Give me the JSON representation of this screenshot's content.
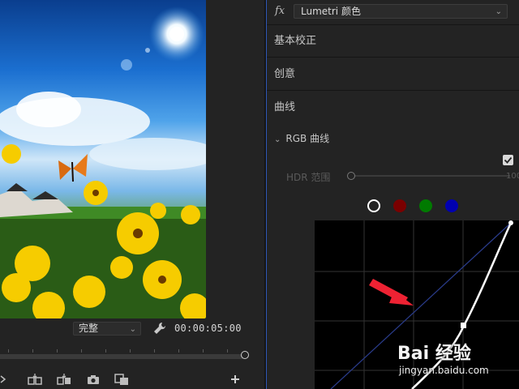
{
  "monitor": {
    "quality": "完整",
    "timecode": "00:00:05:00"
  },
  "lumetri": {
    "effect_label": "fx",
    "effect_name": "Lumetri 颜色",
    "sections": [
      "基本校正",
      "创意",
      "曲线"
    ],
    "rgb_curves": "RGB 曲线",
    "hdr_label": "HDR 范围",
    "hdr_value": "100",
    "channels": [
      {
        "name": "white",
        "color": "#ffffff"
      },
      {
        "name": "red",
        "color": "#7a0000"
      },
      {
        "name": "green",
        "color": "#007a00"
      },
      {
        "name": "blue",
        "color": "#0000b0"
      }
    ]
  },
  "watermark": {
    "brand": "Bai 经验",
    "url": "jingyan.baidu.com"
  },
  "colors": {
    "accent": "#2e56b6",
    "annotation_arrow": "#ee2233"
  }
}
